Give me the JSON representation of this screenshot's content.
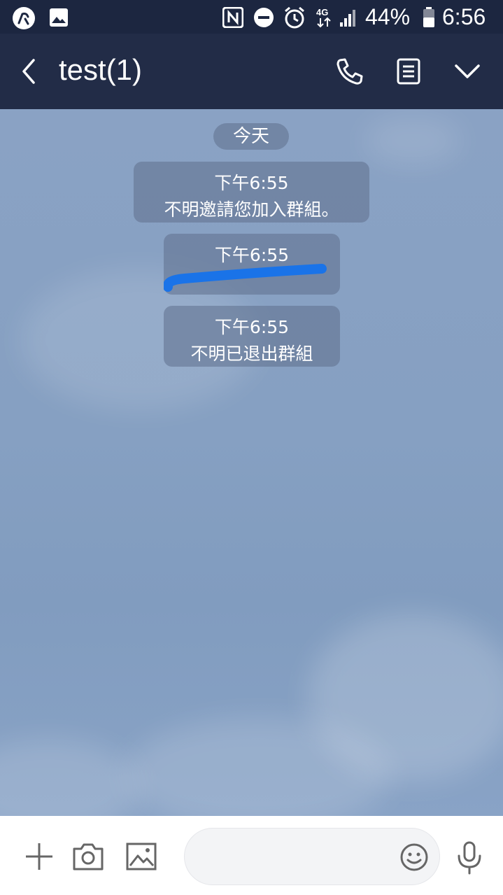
{
  "status_bar": {
    "battery": "44%",
    "time": "6:56",
    "network_badge": "4G",
    "icons": [
      "app-notification-icon",
      "gallery-icon",
      "nfc-icon",
      "do-not-disturb-icon",
      "alarm-icon",
      "network-4g-icon",
      "signal-icon",
      "battery-icon"
    ]
  },
  "header": {
    "title": "test(1)",
    "icons": [
      "back-icon",
      "phone-icon",
      "notes-icon",
      "chevron-down-icon"
    ]
  },
  "chat": {
    "date_label": "今天",
    "messages": [
      {
        "time": "下午6:55",
        "text": "不明邀請您加入群組。"
      },
      {
        "time": "下午6:55",
        "text": ""
      },
      {
        "time": "下午6:55",
        "text": "不明已退出群組"
      }
    ]
  },
  "input_bar": {
    "placeholder": "",
    "icons": [
      "plus-icon",
      "camera-icon",
      "image-icon",
      "emoji-icon",
      "microphone-icon"
    ]
  },
  "colors": {
    "status_bar_bg": "#1c2640",
    "header_bg": "#222c47",
    "chat_bg": "#8aa2c4",
    "bubble_bg": "#6b7f9e",
    "redaction": "#1a73e8"
  }
}
